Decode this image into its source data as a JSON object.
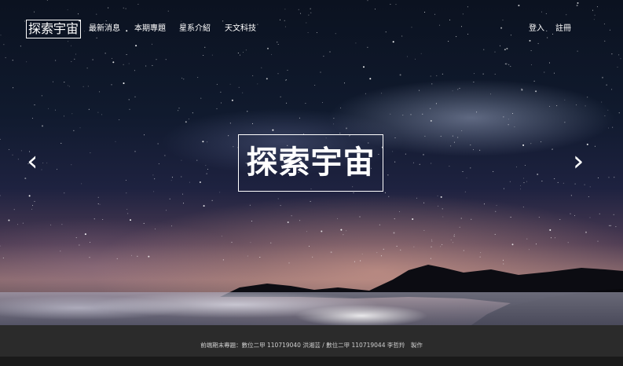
{
  "header": {
    "logo": "探索宇宙",
    "nav": [
      "最新消息",
      "本期專題",
      "星系介紹",
      "天文科技"
    ],
    "auth": {
      "login": "登入",
      "register": "註冊"
    }
  },
  "hero": {
    "title": "探索宇宙",
    "prev_icon": "chevron-left-icon",
    "next_icon": "chevron-right-icon",
    "prev_glyph": "‹",
    "next_glyph": "›"
  },
  "footer": {
    "text": "前端期末專題：數位二甲 110719040 洪湘芸 / 數位二甲 110719044 李哲羚　製作"
  },
  "colors": {
    "text": "#ffffff",
    "footer_bg": "#2b2b2b"
  }
}
